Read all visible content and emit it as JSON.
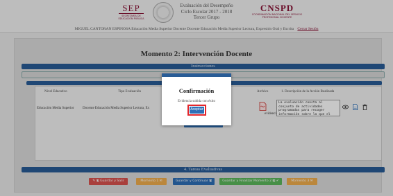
{
  "header": {
    "sep_logo": {
      "big": "SEP",
      "small": "SECRETARÍA DE EDUCACIÓN PÚBLICA"
    },
    "title_lines": [
      "Evaluación del Desempeño",
      "Ciclo Escolar 2017 - 2018",
      "Tercer Grupo"
    ],
    "cnspd_logo": {
      "big": "CNSPD",
      "small": "COORDINACIÓN NACIONAL DEL SERVICIO PROFESIONAL DOCENTE"
    },
    "user_info": "MIGUEL CANTORAN ESPINOSA   Educación Media Superior   Docente   Docente Educación Media Superior Lectura, Expresión Oral y Escrita",
    "logout": "Cerrar Sesión"
  },
  "page": {
    "heading": "Momento 2: Intervención Docente",
    "instructions_bar": "Instrucciones",
    "tareas_bar": "4. Tareas Evaluativas"
  },
  "table": {
    "headers": {
      "nivel": "Nivel Educativo",
      "tipo": "Tipo Evaluación",
      "archivo": "Archivo",
      "descripcion": "1. Descripción de la Acción Realizada"
    },
    "row": {
      "nivel": "Educación Media Superior",
      "tipo": "Docente Educación Media Superior Lectura, Ex",
      "archivo_name": "evidencia 1.pdf",
      "descripcion": "La evaluación consta al conjunto de actividades programadas para recoger información sobre la que el"
    },
    "select_button": "Seleccionar archivo"
  },
  "buttons": {
    "guardar_salir": "✎ 🖫 Guardar y Salir",
    "momento1": "Momento 1 ✉",
    "guardar_continuar": "Guardar y Continuar 🖫",
    "guardar_finalizar": "Guardar y Finalizar Momento 2 🖫 ✔",
    "momento3": "Momento 3 ✉"
  },
  "modal": {
    "title": "Confirmación",
    "message": "Evidencia subida con éxito",
    "accept": "Aceptar"
  },
  "colors": {
    "brand": "#8a1538",
    "bar_blue": "#285c96",
    "button_blue": "#2e6fb7",
    "danger": "#d9534f",
    "warning": "#f0ad4e",
    "success": "#5cb85c",
    "highlight": "#e3262b"
  },
  "icons": [
    "pdf-file-icon",
    "eye-icon",
    "document-icon",
    "trash-icon"
  ]
}
